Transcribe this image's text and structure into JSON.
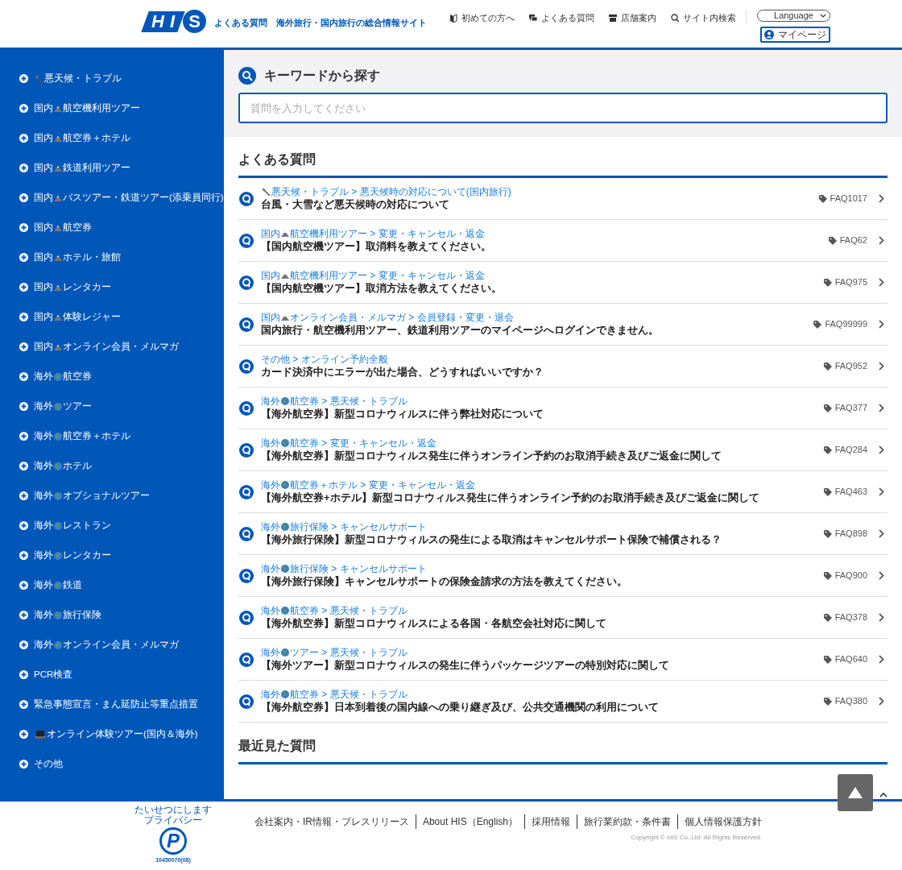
{
  "header": {
    "logo": {
      "letters": [
        "H",
        "I",
        "S"
      ]
    },
    "tagline": "よくある質問　海外旅行・国内旅行の総合情報サイト",
    "nav": [
      {
        "kind": "beginner",
        "label": "初めての方へ"
      },
      {
        "kind": "faq",
        "label": "よくある質問"
      },
      {
        "kind": "store",
        "label": "店舗案内"
      },
      {
        "kind": "search",
        "label": "サイト内検索"
      }
    ],
    "language": "Language",
    "mypage": "マイページ"
  },
  "sidebar": {
    "items": [
      {
        "kind": "weather",
        "after": "悪天候・トラブル"
      },
      {
        "kind": "domestic",
        "before": "国内",
        "after": "航空機利用ツアー"
      },
      {
        "kind": "domestic",
        "before": "国内",
        "after": "航空券＋ホテル"
      },
      {
        "kind": "domestic",
        "before": "国内",
        "after": "鉄道利用ツアー"
      },
      {
        "kind": "domestic",
        "before": "国内",
        "after": "バスツアー・鉄道ツアー(添乗員同行)"
      },
      {
        "kind": "domestic",
        "before": "国内",
        "after": "航空券"
      },
      {
        "kind": "domestic",
        "before": "国内",
        "after": "ホテル・旅館"
      },
      {
        "kind": "domestic",
        "before": "国内",
        "after": "レンタカー"
      },
      {
        "kind": "domestic",
        "before": "国内",
        "after": "体験レジャー"
      },
      {
        "kind": "domestic",
        "before": "国内",
        "after": "オンライン会員・メルマガ"
      },
      {
        "kind": "overseas",
        "before": "海外",
        "after": "航空券"
      },
      {
        "kind": "overseas",
        "before": "海外",
        "after": "ツアー"
      },
      {
        "kind": "overseas",
        "before": "海外",
        "after": "航空券＋ホテル"
      },
      {
        "kind": "overseas",
        "before": "海外",
        "after": "ホテル"
      },
      {
        "kind": "overseas",
        "before": "海外",
        "after": "オプショナルツアー"
      },
      {
        "kind": "overseas",
        "before": "海外",
        "after": "レストラン"
      },
      {
        "kind": "overseas",
        "before": "海外",
        "after": "レンタカー"
      },
      {
        "kind": "overseas",
        "before": "海外",
        "after": "鉄道"
      },
      {
        "kind": "overseas",
        "before": "海外",
        "after": "旅行保険"
      },
      {
        "kind": "overseas",
        "before": "海外",
        "after": "オンライン会員・メルマガ"
      },
      {
        "kind": "plain",
        "after": "PCR検査"
      },
      {
        "kind": "plain",
        "after": "緊急事態宣言・まん延防止等重点措置"
      },
      {
        "kind": "online",
        "after": "オンライン体験ツアー(国内＆海外)"
      },
      {
        "kind": "plain",
        "after": "その他"
      }
    ]
  },
  "search": {
    "title": "キーワードから探す",
    "placeholder": "質問を入力してください"
  },
  "faq": {
    "title": "よくある質問",
    "rows": [
      {
        "kind": "weather",
        "after": "悪天候・トラブル > 悪天候時の対応について(国内旅行)",
        "question": "台風・大雪など悪天候時の対応について",
        "id": "FAQ1017"
      },
      {
        "kind": "domestic",
        "before": "国内",
        "after": "航空機利用ツアー > 変更・キャンセル・返金",
        "question": "【国内航空機ツアー】取消料を教えてください。",
        "id": "FAQ62"
      },
      {
        "kind": "domestic",
        "before": "国内",
        "after": "航空機利用ツアー > 変更・キャンセル・返金",
        "question": "【国内航空機ツアー】取消方法を教えてください。",
        "id": "FAQ975"
      },
      {
        "kind": "domestic",
        "before": "国内",
        "after": "オンライン会員・メルマガ > 会員登録・変更・退会",
        "question": "国内旅行・航空機利用ツアー、鉄道利用ツアーのマイページへログインできません。",
        "id": "FAQ99999"
      },
      {
        "kind": "plain",
        "after": "その他 > オンライン予約全般",
        "question": "カード決済中にエラーが出た場合、どうすればいいですか？",
        "id": "FAQ952"
      },
      {
        "kind": "overseas",
        "before": "海外",
        "after": "航空券 > 悪天候・トラブル",
        "question": "【海外航空券】新型コロナウィルスに伴う弊社対応について",
        "id": "FAQ377"
      },
      {
        "kind": "overseas",
        "before": "海外",
        "after": "航空券 > 変更・キャンセル・返金",
        "question": "【海外航空券】新型コロナウィルス発生に伴うオンライン予約のお取消手続き及びご返金に関して",
        "id": "FAQ284"
      },
      {
        "kind": "overseas",
        "before": "海外",
        "after": "航空券＋ホテル > 変更・キャンセル・返金",
        "question": "【海外航空券+ホテル】新型コロナウィルス発生に伴うオンライン予約のお取消手続き及びご返金に関して",
        "id": "FAQ463"
      },
      {
        "kind": "overseas",
        "before": "海外",
        "after": "旅行保険 > キャンセルサポート",
        "question": "【海外旅行保険】新型コロナウィルスの発生による取消はキャンセルサポート保険で補償される？",
        "id": "FAQ898"
      },
      {
        "kind": "overseas",
        "before": "海外",
        "after": "旅行保険 > キャンセルサポート",
        "question": "【海外旅行保険】キャンセルサポートの保険金請求の方法を教えてください。",
        "id": "FAQ900"
      },
      {
        "kind": "overseas",
        "before": "海外",
        "after": "航空券 > 悪天候・トラブル",
        "question": "【海外航空券】新型コロナウィルスによる各国・各航空会社対応に関して",
        "id": "FAQ378"
      },
      {
        "kind": "overseas",
        "before": "海外",
        "after": "ツアー > 悪天候・トラブル",
        "question": "【海外ツアー】新型コロナウィルスの発生に伴うパッケージツアーの特別対応に関して",
        "id": "FAQ640"
      },
      {
        "kind": "overseas",
        "before": "海外",
        "after": "航空券 > 悪天候・トラブル",
        "question": "【海外航空券】日本到着後の国内線への乗り継ぎ及び、公共交通機関の利用について",
        "id": "FAQ380"
      }
    ]
  },
  "recent": {
    "title": "最近見た質問"
  },
  "footer": {
    "privacy_mark": {
      "caption": [
        "たいせつにします",
        "プライバシー"
      ],
      "letter": "P",
      "number": "10450070(08)"
    },
    "links": [
      "会社案内・IR情報・プレスリリース",
      "About HIS（English）",
      "採用情報",
      "旅行業約款・条件書",
      "個人情報保護方針"
    ],
    "copyright": "Copyright © HIS Co.,Ltd. All Rights Reserved."
  }
}
